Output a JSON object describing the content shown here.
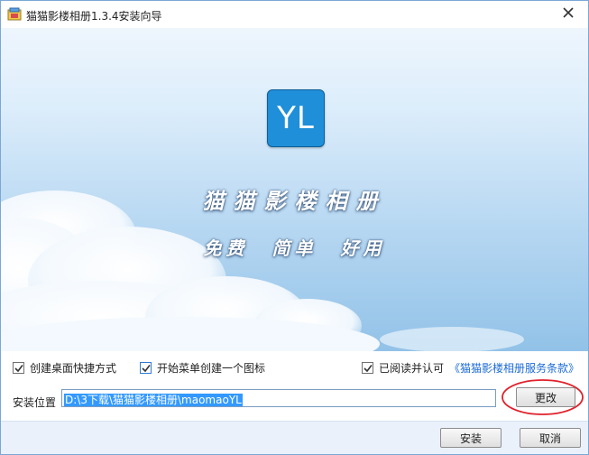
{
  "window": {
    "title": "猫猫影楼相册1.3.4安装向导"
  },
  "banner": {
    "logo_text": "YL",
    "app_name": "猫猫影楼相册",
    "slogan": "免费 简单 好用"
  },
  "options": {
    "desktop_shortcut": {
      "label": "创建桌面快捷方式",
      "checked": true
    },
    "start_menu": {
      "label": "开始菜单创建一个图标",
      "checked": true
    },
    "agree": {
      "label": "已阅读并认可",
      "checked": true,
      "link": "《猫猫影楼相册服务条款》"
    },
    "install_location_label": "安装位置",
    "install_path": "D:\\3下载\\猫猫影楼相册\\maomaoYL",
    "change_button": "更改"
  },
  "footer": {
    "install_button": "安装",
    "cancel_button": "取消"
  },
  "colors": {
    "accent": "#3399ff",
    "logo": "#1f8fd9",
    "annotation": "#e0202a",
    "link": "#1c6bd6"
  }
}
